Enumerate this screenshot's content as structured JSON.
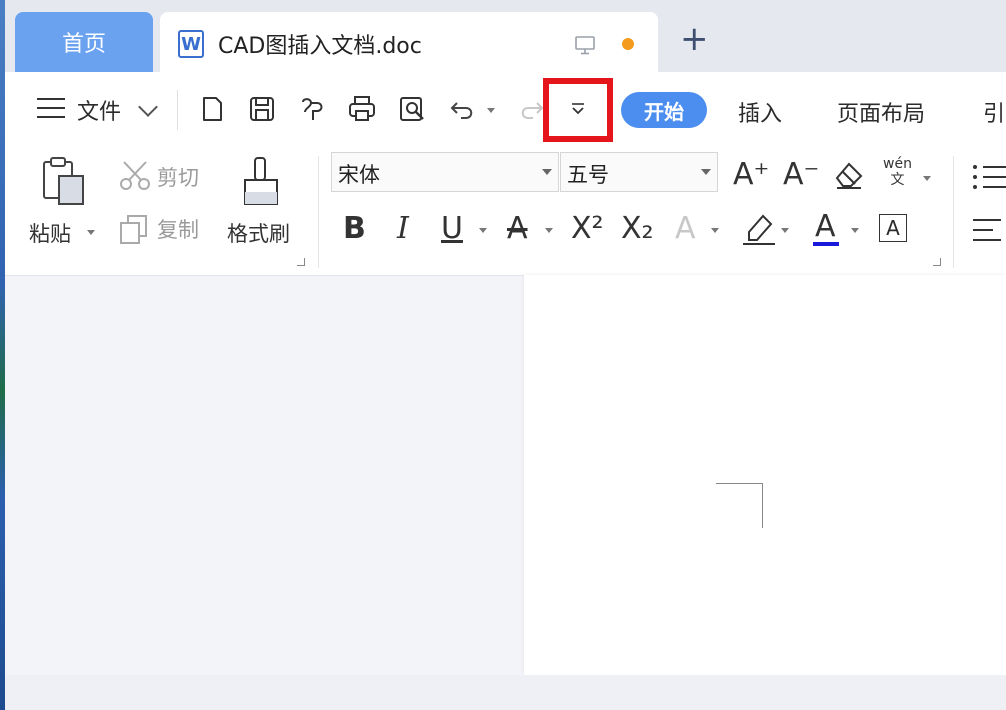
{
  "tabs": {
    "home_label": "首页",
    "doc_icon_letter": "W",
    "doc_title": "CAD图插入文档.doc",
    "new_tab_symbol": "+"
  },
  "toolbar": {
    "file_label": "文件",
    "active_tab": "开始",
    "tabs": [
      "插入",
      "页面布局",
      "引"
    ]
  },
  "clipboard": {
    "paste": "粘贴",
    "cut": "剪切",
    "copy": "复制",
    "format_painter": "格式刷"
  },
  "font": {
    "family": "宋体",
    "size": "五号",
    "bold": "B",
    "italic": "I",
    "underline": "U",
    "strike": "A",
    "superscript": "X²",
    "subscript": "X₂",
    "text_effect": "A",
    "font_color": "A",
    "char_border": "A",
    "grow": "A⁺",
    "shrink": "A⁻",
    "pinyin": "wén\n文"
  },
  "colors": {
    "accent": "#4c8ef0",
    "home_tab": "#6aa2f0",
    "highlight_box": "#e4161b",
    "unsaved_dot": "#f29b1e",
    "font_color_bar": "#1a1adb"
  }
}
